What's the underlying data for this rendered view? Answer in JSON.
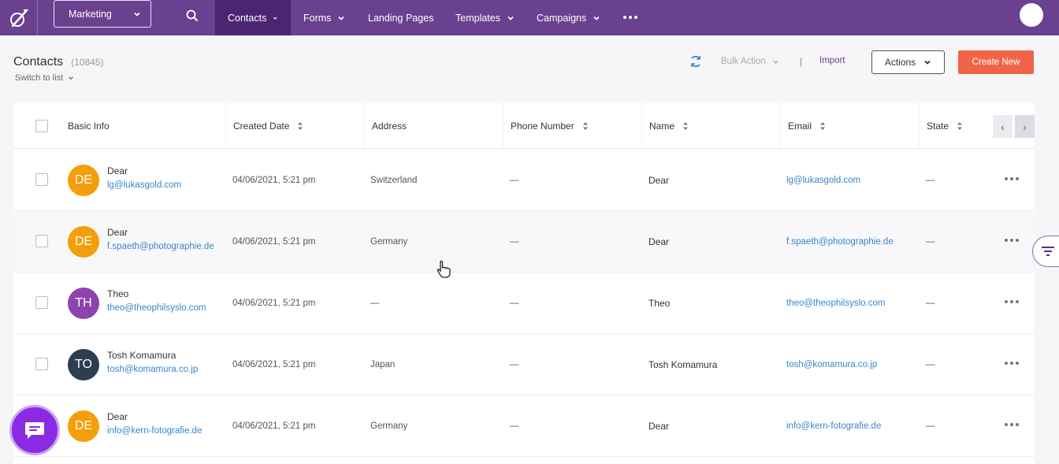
{
  "nav": {
    "workspace": "Marketing",
    "items": [
      {
        "label": "Contacts",
        "active": true
      },
      {
        "label": "Forms"
      },
      {
        "label": "Landing Pages"
      },
      {
        "label": "Templates"
      },
      {
        "label": "Campaigns"
      }
    ]
  },
  "header": {
    "title": "Contacts",
    "count": "(10845)",
    "switch_label": "Switch to list",
    "bulk_action": "Bulk Action",
    "separator": "|",
    "import": "Import",
    "actions": "Actions",
    "create_new": "Create New"
  },
  "table": {
    "columns": [
      "Basic Info",
      "Created Date",
      "Address",
      "Phone Number",
      "Name",
      "Email",
      "State"
    ],
    "rows": [
      {
        "initials": "DE",
        "avatar_color": "#f59e0b",
        "name": "Dear",
        "email": "lg@lukasgold.com",
        "created": "04/06/2021, 5:21 pm",
        "address": "Switzerland",
        "phone": "—",
        "display_name": "Dear",
        "state": "—"
      },
      {
        "initials": "DE",
        "avatar_color": "#f59e0b",
        "name": "Dear",
        "email": "f.spaeth@photographie.de",
        "created": "04/06/2021, 5:21 pm",
        "address": "Germany",
        "phone": "—",
        "display_name": "Dear",
        "state": "—"
      },
      {
        "initials": "TH",
        "avatar_color": "#8e44ad",
        "name": "Theo",
        "email": "theo@theophilsyslo.com",
        "created": "04/06/2021, 5:21 pm",
        "address": "—",
        "phone": "—",
        "display_name": "Theo",
        "state": "—"
      },
      {
        "initials": "TO",
        "avatar_color": "#2c3e50",
        "name": "Tosh Komamura",
        "email": "tosh@komamura.co.jp",
        "created": "04/06/2021, 5:21 pm",
        "address": "Japan",
        "phone": "—",
        "display_name": "Tosh Komamura",
        "state": "—"
      },
      {
        "initials": "DE",
        "avatar_color": "#f59e0b",
        "name": "Dear",
        "email": "info@kern-fotografie.de",
        "created": "04/06/2021, 5:21 pm",
        "address": "Germany",
        "phone": "—",
        "display_name": "Dear",
        "state": "—"
      }
    ]
  },
  "colors": {
    "nav_bg": "#6a418f",
    "nav_active": "#4b2572",
    "accent": "#f26448",
    "link": "#3a86c8"
  }
}
